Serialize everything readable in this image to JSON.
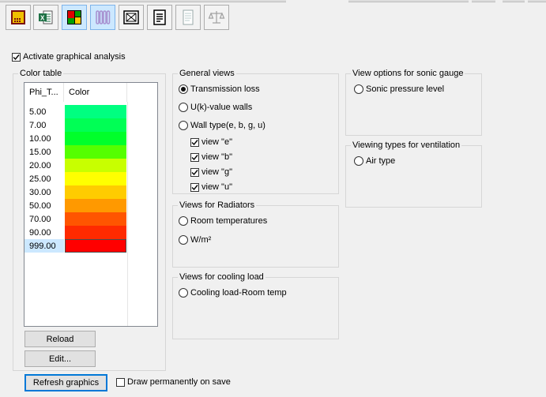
{
  "toolbar": {
    "buttons": [
      {
        "icon": "heat-load-icon",
        "active": false
      },
      {
        "icon": "excel-export-icon",
        "active": false
      },
      {
        "icon": "floor-plan-color-icon",
        "active": true
      },
      {
        "icon": "radiator-icon",
        "active": true
      },
      {
        "icon": "frame-view-icon",
        "active": false
      },
      {
        "icon": "report-icon",
        "active": false
      },
      {
        "icon": "document-icon",
        "active": false
      },
      {
        "icon": "balance-scale-icon",
        "active": false
      }
    ]
  },
  "activate": {
    "label": "Activate graphical analysis",
    "checked": true
  },
  "color_table": {
    "title": "Color table",
    "col_value": "Phi_T...",
    "col_color": "Color",
    "rows": [
      {
        "value": "5.00",
        "color": "#00ff80"
      },
      {
        "value": "7.00",
        "color": "#00ff55"
      },
      {
        "value": "10.00",
        "color": "#00ff2b"
      },
      {
        "value": "15.00",
        "color": "#55ff00"
      },
      {
        "value": "20.00",
        "color": "#c8ff00"
      },
      {
        "value": "25.00",
        "color": "#ffff00"
      },
      {
        "value": "30.00",
        "color": "#ffcc00"
      },
      {
        "value": "50.00",
        "color": "#ff9900"
      },
      {
        "value": "70.00",
        "color": "#ff5500"
      },
      {
        "value": "90.00",
        "color": "#ff2a00"
      },
      {
        "value": "999.00",
        "color": "#ff0000",
        "selected": true
      }
    ],
    "reload_label": "Reload",
    "edit_label": "Edit..."
  },
  "general_views": {
    "title": "General views",
    "options": [
      {
        "label": "Transmission loss",
        "selected": true
      },
      {
        "label": "U(k)-value walls",
        "selected": false
      },
      {
        "label": "Wall type(e, b, g, u)",
        "selected": false
      }
    ],
    "wall_checks": [
      {
        "label": "view \"e\"",
        "checked": true
      },
      {
        "label": "view \"b\"",
        "checked": true
      },
      {
        "label": "view \"g\"",
        "checked": true
      },
      {
        "label": "view \"u\"",
        "checked": true
      }
    ]
  },
  "radiators": {
    "title": "Views for Radiators",
    "options": [
      {
        "label": "Room temperatures",
        "selected": false
      },
      {
        "label": "W/m²",
        "selected": false
      }
    ]
  },
  "cooling": {
    "title": "Views for cooling load",
    "options": [
      {
        "label": "Cooling load-Room temp",
        "selected": false
      }
    ]
  },
  "sonic": {
    "title": "View options for sonic gauge",
    "options": [
      {
        "label": "Sonic pressure level",
        "selected": false
      }
    ]
  },
  "ventilation": {
    "title": "Viewing types for ventilation",
    "options": [
      {
        "label": "Air type",
        "selected": false
      }
    ]
  },
  "bottom": {
    "refresh_label": "Refresh graphics",
    "draw_label": "Draw permanently on save",
    "draw_checked": false
  }
}
